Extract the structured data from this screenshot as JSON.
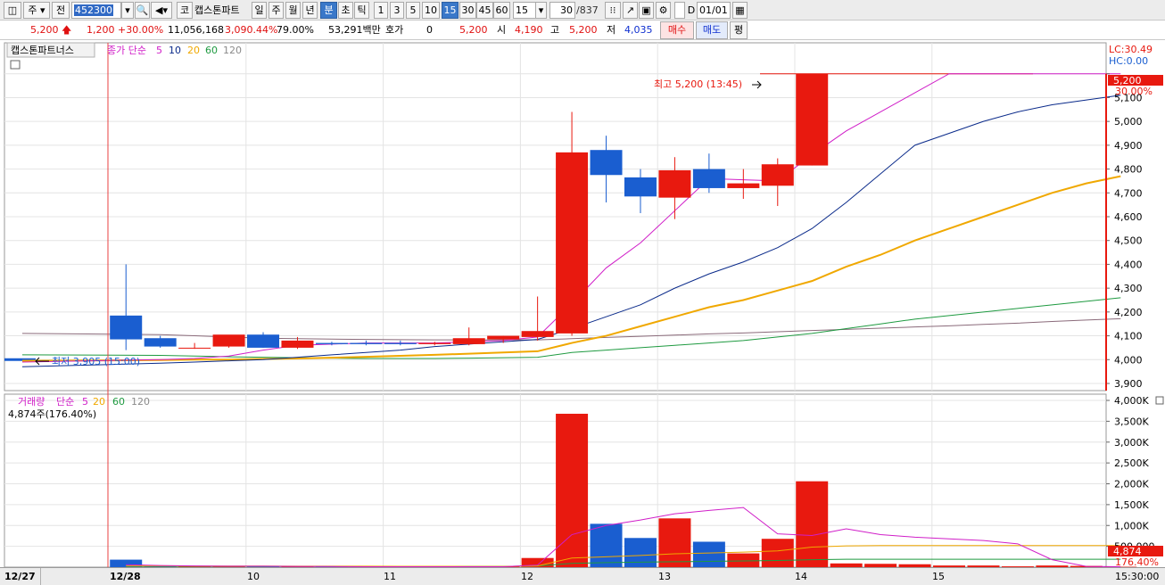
{
  "toolbar": {
    "period_type": "주",
    "all_label": "전",
    "stock_code": "452300",
    "market_label": "코",
    "stock_name": "캡스톤파트",
    "intervals": [
      "일",
      "주",
      "월",
      "년",
      "분",
      "초",
      "틱"
    ],
    "selected_interval": "분",
    "minute_options": [
      "1",
      "3",
      "5",
      "10",
      "15",
      "30",
      "45",
      "60"
    ],
    "selected_minute": "15",
    "minute_select_value": "15",
    "count_value": "30",
    "count_total": "/837",
    "date_value": "01/01",
    "d_label": "D"
  },
  "quote": {
    "price": "5,200",
    "change": "1,200",
    "change_pct": "+30.00%",
    "volume": "11,056,168",
    "volume_ratio": "3,090.44%",
    "turnover_pct": "79.00%",
    "amount": "53,291백만",
    "hoga_label": "호가",
    "hoga_value": "0",
    "ask_price": "5,200",
    "open_label": "시",
    "open": "4,190",
    "high_label": "고",
    "high": "5,200",
    "low_label": "저",
    "low": "4,035",
    "buy_label": "매수",
    "sell_label": "매도",
    "eval_label": "평"
  },
  "price_panel": {
    "title": "캡스톤파트너스",
    "legend_label": "종가 단순",
    "ma_labels": [
      "5",
      "10",
      "20",
      "60",
      "120"
    ],
    "lc": "LC:30.49",
    "hc": "HC:0.00",
    "high_note": "최고 5,200 (13:45)",
    "low_note": "최저 3,905 (15:00)",
    "current_tag": "5,200",
    "current_pct": "30.00%",
    "y_ticks": [
      "5,200",
      "5,100",
      "5,000",
      "4,900",
      "4,800",
      "4,700",
      "4,600",
      "4,500",
      "4,400",
      "4,300",
      "4,200",
      "4,100",
      "4,000",
      "3,900"
    ]
  },
  "volume_panel": {
    "legend_label": "거래량",
    "legend_type": "단순",
    "ma_labels": [
      "5",
      "20",
      "60",
      "120"
    ],
    "current_value": "4,874주(176.40%)",
    "current_tag": "4,874",
    "current_pct": "176.40%",
    "y_ticks": [
      "4,000K",
      "3,500K",
      "3,000K",
      "2,500K",
      "2,000K",
      "1,500K",
      "1,000K",
      "500,000"
    ]
  },
  "xaxis": {
    "labels": [
      "12/27",
      "12/28",
      "10",
      "11",
      "12",
      "13",
      "14",
      "15"
    ],
    "time": "15:30:00"
  },
  "colors": {
    "up": "#e8190f",
    "down": "#1a5ed0",
    "ma5": "#d01ec8",
    "ma10": "#0a2a8a",
    "ma20": "#f0a800",
    "ma60": "#1e9a40",
    "ma120": "#8a6a7a"
  },
  "chart_data": {
    "type": "candlestick",
    "candles": [
      {
        "o": 4185,
        "h": 4400,
        "l": 4040,
        "c": 4085
      },
      {
        "o": 4090,
        "h": 4100,
        "l": 4050,
        "c": 4055
      },
      {
        "o": 4050,
        "h": 4070,
        "l": 4045,
        "c": 4050
      },
      {
        "o": 4055,
        "h": 4100,
        "l": 4050,
        "c": 4105
      },
      {
        "o": 4105,
        "h": 4115,
        "l": 4050,
        "c": 4050
      },
      {
        "o": 4050,
        "h": 4095,
        "l": 4045,
        "c": 4080
      },
      {
        "o": 4070,
        "h": 4075,
        "l": 4060,
        "c": 4065
      },
      {
        "o": 4070,
        "h": 4080,
        "l": 4060,
        "c": 4065
      },
      {
        "o": 4070,
        "h": 4080,
        "l": 4060,
        "c": 4065
      },
      {
        "o": 4065,
        "h": 4075,
        "l": 4060,
        "c": 4070
      },
      {
        "o": 4065,
        "h": 4135,
        "l": 4060,
        "c": 4090
      },
      {
        "o": 4085,
        "h": 4100,
        "l": 4070,
        "c": 4100
      },
      {
        "o": 4095,
        "h": 4265,
        "l": 4080,
        "c": 4120
      },
      {
        "o": 4110,
        "h": 5040,
        "l": 4100,
        "c": 4870
      },
      {
        "o": 4880,
        "h": 4940,
        "l": 4660,
        "c": 4775
      },
      {
        "o": 4765,
        "h": 4800,
        "l": 4615,
        "c": 4685
      },
      {
        "o": 4680,
        "h": 4850,
        "l": 4590,
        "c": 4795
      },
      {
        "o": 4800,
        "h": 4865,
        "l": 4700,
        "c": 4720
      },
      {
        "o": 4720,
        "h": 4800,
        "l": 4675,
        "c": 4740
      },
      {
        "o": 4730,
        "h": 4845,
        "l": 4645,
        "c": 4820
      },
      {
        "o": 4815,
        "h": 5200,
        "l": 4815,
        "c": 5200
      },
      {
        "o": 5200,
        "h": 5200,
        "l": 5200,
        "c": 5200
      },
      {
        "o": 5200,
        "h": 5200,
        "l": 5200,
        "c": 5200
      },
      {
        "o": 5200,
        "h": 5200,
        "l": 5200,
        "c": 5200
      },
      {
        "o": 5200,
        "h": 5200,
        "l": 5200,
        "c": 5200
      },
      {
        "o": 5200,
        "h": 5200,
        "l": 5200,
        "c": 5200
      },
      {
        "o": 5200,
        "h": 5200,
        "l": 5200,
        "c": 5200
      },
      {
        "o": 5200,
        "h": 5200,
        "l": 5200,
        "c": 5200
      },
      {
        "o": 5200,
        "h": 5200,
        "l": 5200,
        "c": 5200
      },
      {
        "o": 5200,
        "h": 5200,
        "l": 5200,
        "c": 5200
      }
    ],
    "prev_close": 4000,
    "volume_k": [
      180,
      20,
      15,
      20,
      30,
      25,
      10,
      10,
      10,
      10,
      12,
      15,
      220,
      3680,
      1040,
      700,
      1170,
      610,
      330,
      680,
      2060,
      90,
      80,
      70,
      40,
      40,
      20,
      40,
      30,
      10
    ],
    "ma5_price": [
      3990,
      4000,
      4005,
      4015,
      4040,
      4060,
      4065,
      4070,
      4070,
      4070,
      4075,
      4080,
      4095,
      4235,
      4385,
      4490,
      4625,
      4760,
      4755,
      4750,
      4860,
      4960,
      5040,
      5120,
      5200,
      5200,
      5200,
      5200,
      5200,
      5200
    ],
    "ma10_price": [
      3970,
      3985,
      3990,
      3995,
      4000,
      4010,
      4020,
      4030,
      4040,
      4055,
      4065,
      4075,
      4085,
      4130,
      4180,
      4230,
      4300,
      4360,
      4410,
      4470,
      4550,
      4660,
      4780,
      4900,
      4950,
      5000,
      5040,
      5070,
      5090,
      5110
    ],
    "ma20_price": [
      3995,
      3998,
      4000,
      4000,
      4003,
      4005,
      4008,
      4012,
      4016,
      4020,
      4025,
      4030,
      4035,
      4070,
      4100,
      4140,
      4180,
      4220,
      4250,
      4290,
      4330,
      4390,
      4440,
      4500,
      4550,
      4600,
      4650,
      4700,
      4740,
      4770
    ],
    "ma60_price": [
      4020,
      4018,
      4015,
      4012,
      4010,
      4008,
      4006,
      4005,
      4005,
      4005,
      4006,
      4008,
      4010,
      4030,
      4040,
      4050,
      4060,
      4070,
      4080,
      4095,
      4110,
      4130,
      4150,
      4170,
      4185,
      4200,
      4215,
      4230,
      4245,
      4260
    ],
    "ma120_price": [
      4110,
      4105,
      4100,
      4095,
      4090,
      4088,
      4086,
      4085,
      4084,
      4083,
      4083,
      4083,
      4083,
      4088,
      4093,
      4098,
      4103,
      4108,
      4112,
      4117,
      4122,
      4127,
      4132,
      4137,
      4142,
      4148,
      4153,
      4160,
      4166,
      4172
    ],
    "ma5_vol_k": [
      60,
      40,
      30,
      25,
      25,
      20,
      15,
      12,
      11,
      10,
      11,
      12,
      50,
      780,
      1000,
      1130,
      1280,
      1360,
      1430,
      800,
      760,
      920,
      780,
      720,
      680,
      640,
      560,
      180,
      20,
      10
    ],
    "ma20_vol_k": [
      30,
      30,
      28,
      27,
      26,
      25,
      24,
      23,
      22,
      21,
      20,
      20,
      30,
      220,
      250,
      280,
      320,
      340,
      360,
      390,
      480,
      510,
      520,
      520,
      520,
      520,
      520,
      520,
      520,
      520
    ],
    "ma60_vol_k": [
      20,
      20,
      20,
      20,
      20,
      20,
      20,
      20,
      20,
      20,
      20,
      20,
      30,
      90,
      110,
      120,
      130,
      140,
      150,
      160,
      180,
      190,
      190,
      190,
      190,
      190,
      190,
      190,
      190,
      190
    ],
    "ylim_price": [
      3870,
      5330
    ],
    "ylim_volume_k": [
      0,
      4150
    ]
  }
}
